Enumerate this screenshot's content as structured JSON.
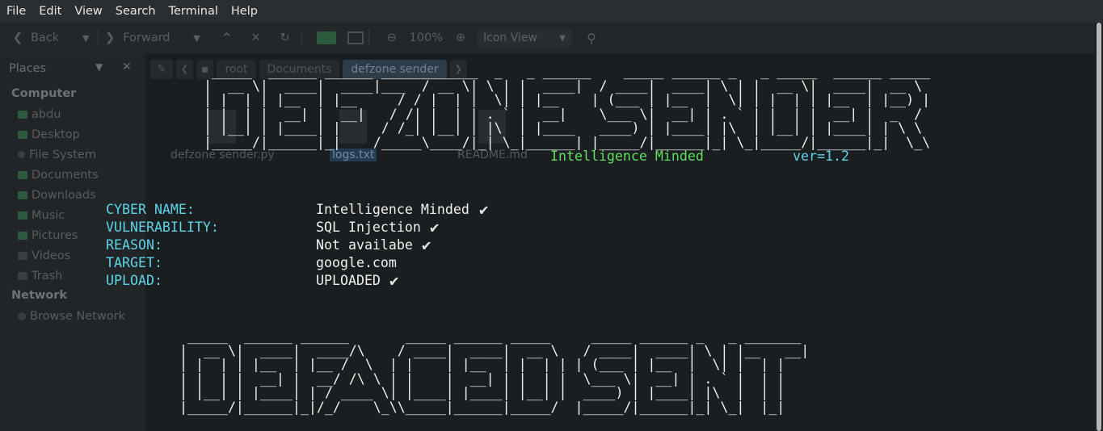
{
  "menubar": {
    "items": [
      "File",
      "Edit",
      "View",
      "Search",
      "Terminal",
      "Help"
    ]
  },
  "file_manager": {
    "toolbar": {
      "back": "Back",
      "forward": "Forward",
      "zoom": "100%",
      "view_mode": "Icon View"
    },
    "sidebar": {
      "title": "Places",
      "computer_heading": "Computer",
      "items": [
        {
          "label": "abdu",
          "icon": "home-icon"
        },
        {
          "label": "Desktop",
          "icon": "desktop-icon"
        },
        {
          "label": "File System",
          "icon": "drive-icon"
        },
        {
          "label": "Documents",
          "icon": "folder-icon"
        },
        {
          "label": "Downloads",
          "icon": "folder-icon"
        },
        {
          "label": "Music",
          "icon": "folder-icon"
        },
        {
          "label": "Pictures",
          "icon": "folder-icon"
        },
        {
          "label": "Videos",
          "icon": "folder-icon"
        },
        {
          "label": "Trash",
          "icon": "trash-icon"
        }
      ],
      "network_heading": "Network",
      "network_items": [
        {
          "label": "Browse Network",
          "icon": "network-icon"
        }
      ]
    },
    "path": [
      "root",
      "Documents",
      "defzone sender"
    ],
    "files": [
      "defzone sender.py",
      "logs.txt",
      "README.md"
    ]
  },
  "terminal": {
    "banner_ascii": [
      " _____  ______ ______ ____________  _   _ ______    _____ ______ _   _ _____  ______ _____  ",
      "|  __ \\|  ____|  ____|___  / __ \\| \\ | |  ____|  / ____|  ____| \\ | |  __ \\|  ____|  __ \\ ",
      "| |  | | |__  | |__     / / |  | |  \\| | |__    | (___ | |__  |  \\| | |  | | |__  | |__) |",
      "| |  | |  __| |  __|   / /| |  | | . ` |  __|    \\___ \\|  __| | . ` | |  | |  __| |  _  / ",
      "| |__| | |____| |     / /_| |__| | |\\  | |____   ____) | |____| |\\  | |__| | |____| | \\ \\ ",
      "|_____/|______|_|    /_____\\____/|_| \\_|______| |_____/|______|_| \\_|_____/|______|_|  \\_\\"
    ],
    "tagline": "Intelligence Minded",
    "version": "ver=1.2",
    "info": [
      {
        "label": "CYBER NAME:",
        "value": "Intelligence Minded",
        "check": "✔"
      },
      {
        "label": "VULNERABILITY:",
        "value": "SQL Injection",
        "check": "✔"
      },
      {
        "label": "REASON:",
        "value": "Not availabe",
        "check": "✔"
      },
      {
        "label": "TARGET:",
        "value": "google.com",
        "check": ""
      },
      {
        "label": "UPLOAD:",
        "value": "UPLOADED",
        "check": "✔"
      }
    ],
    "footer_ascii": [
      " _____  ______ ______       _____ ______ _____     _____ ______ _   _ _______ ",
      "|  __ \\|  ____|  ____/\\    / ____|  ____|  __ \\   / ____|  ____| \\ | |__   __|",
      "| |  | | |__  | |__ /  \\  | |    | |__  | |  | | | (___ | |__  |  \\| |  | |   ",
      "| |  | |  __| |  __/ /\\ \\ | |    |  __| | |  | |  \\___ \\|  __| | . ` |  | |   ",
      "| |__| | |____| | / ____ \\| |____| |____| |__| |  ____) | |____| |\\  |  | |   ",
      "|_____/|______|_|/_/    \\_\\\\_____|______|_____/  |_____/|______|_| \\_|  |_|   "
    ]
  },
  "colors": {
    "green": "#5ee05e",
    "cyan": "#5cd4e6",
    "text": "#eef0f0",
    "background": "#1f2224"
  }
}
